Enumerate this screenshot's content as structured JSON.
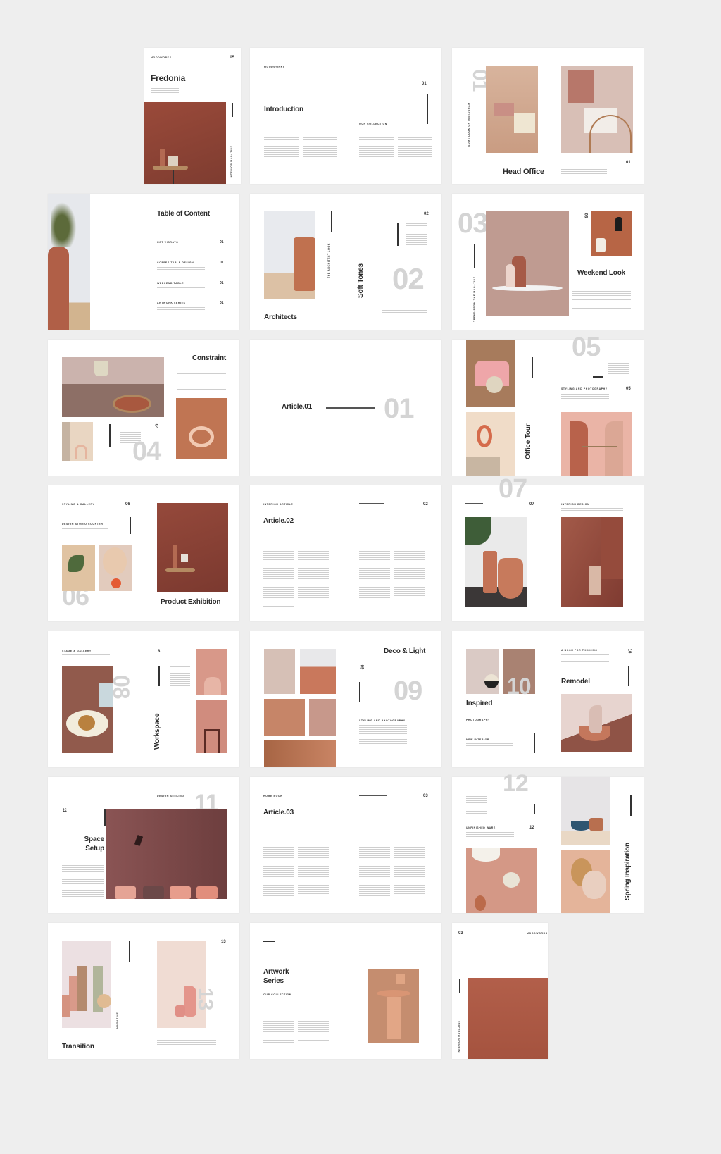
{
  "colors": {
    "background": "#eeeeee",
    "page": "#ffffff",
    "terracotta": "#a65a47",
    "accent_gray": "#d4d4d4",
    "text": "#2a2a2a"
  },
  "spreads": [
    {
      "id": "cover",
      "title": "Fredonia",
      "label": "MOODWORKS",
      "page_number": "05",
      "vertical_label": "INTERIOR MAGAZINE"
    },
    {
      "id": "introduction",
      "title": "Introduction",
      "label": "MOODWORKS",
      "page_number": "01",
      "subheading": "OUR COLLECTION"
    },
    {
      "id": "head-office",
      "title": "Head Office",
      "big_number": "01",
      "vertical_label": "SOME LOOK ON INSTAGRAM",
      "page_number": "01"
    },
    {
      "id": "table-of-content",
      "title": "Table of Content",
      "items": [
        {
          "label": "HOT VIBRATO",
          "page": "01"
        },
        {
          "label": "COFFEE TABLE DESIGN",
          "page": "01"
        },
        {
          "label": "WEEKEND TABLE",
          "page": "01"
        },
        {
          "label": "ARTWORK SERIES",
          "page": "01"
        }
      ]
    },
    {
      "id": "soft-tones",
      "title": "Architects",
      "vertical_title": "Soft Tones",
      "big_number": "02",
      "page_number": "02",
      "vertical_label": "THE ARCHITECT LOOK"
    },
    {
      "id": "weekend-look",
      "title": "Weekend Look",
      "big_number": "03",
      "page_number": "03",
      "vertical_label": "TREND FROM THE MAGAZINE"
    },
    {
      "id": "constraint",
      "title": "Constraint",
      "big_number": "04",
      "page_number": "04"
    },
    {
      "id": "article-01",
      "title": "Article.01",
      "big_number": "01"
    },
    {
      "id": "office-tour",
      "vertical_title": "Office Tour",
      "big_number": "05",
      "page_number": "05",
      "subheading": "STYLING AND PHOTOGRAPHY"
    },
    {
      "id": "product-exhibition",
      "title": "Product Exhibition",
      "big_number": "06",
      "page_number": "06",
      "subheading_1": "STYLING & GALLERY",
      "subheading_2": "DESIGN STUDIO COUNTER"
    },
    {
      "id": "article-02",
      "title": "Article.02",
      "page_number": "02",
      "label": "INTERIOR ARTICLE"
    },
    {
      "id": "spread-07",
      "big_number": "07",
      "page_number": "07",
      "label": "INTERIOR DESIGN"
    },
    {
      "id": "workspace",
      "vertical_title": "Workspace",
      "big_number": "08",
      "page_number": "8",
      "subheading": "STAGE & GALLERY"
    },
    {
      "id": "deco-light",
      "title": "Deco & Light",
      "big_number": "09",
      "page_number": "09",
      "subheading": "STYLING AND PHOTOGRAPHY"
    },
    {
      "id": "inspired-remodel",
      "title": "Inspired",
      "title_2": "Remodel",
      "big_number": "10",
      "page_number": "10",
      "subheading": "PHOTOGRAPHY",
      "subheading_2": "NEW INTERIOR",
      "label": "A BOOK FOR THINKING"
    },
    {
      "id": "space-setup",
      "title": "Space",
      "title_line2": "Setup",
      "big_number": "11",
      "page_number": "11",
      "label": "DESIGN SEEKING"
    },
    {
      "id": "article-03",
      "title": "Article.03",
      "page_number": "03",
      "label": "HOME BOOK"
    },
    {
      "id": "spring-inspiration",
      "vertical_title": "Spring Inspiration",
      "big_number": "12",
      "page_number": "12",
      "subheading": "UNFINISHED WARE"
    },
    {
      "id": "transition",
      "title": "Transition",
      "big_number": "13",
      "page_number": "13",
      "vertical_label": "MAGAZINE"
    },
    {
      "id": "artwork-series",
      "title": "Artwork",
      "title_line2": "Series",
      "subheading": "OUR COLLECTION"
    },
    {
      "id": "back-cover",
      "page_number": "03",
      "label": "MOODWORKS",
      "vertical_label": "INTERIOR MAGAZINE"
    }
  ]
}
